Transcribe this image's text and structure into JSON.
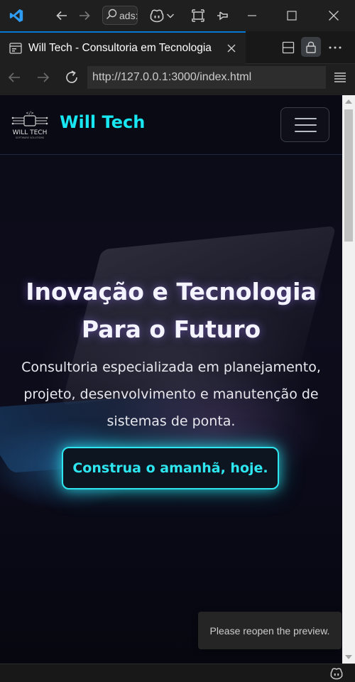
{
  "titlebar": {
    "search_text": "ads:",
    "icons": [
      "vscode-logo-icon",
      "arrow-left-icon",
      "arrow-right-icon",
      "search-icon",
      "copilot-icon",
      "chevron-down-icon",
      "layout-icon",
      "pin-icon",
      "minimize-icon",
      "maximize-icon",
      "close-icon"
    ]
  },
  "tab": {
    "title": "Will Tech - Consultoria em Tecnologia"
  },
  "address_bar": {
    "url": "http://127.0.0.1:3000/index.html"
  },
  "site": {
    "brand": "Will Tech",
    "logo_text": "WILL TECH",
    "logo_subtext": "SOFTWARE SOLUTIONS",
    "hero_title_line1": "Inovação e Tecnologia",
    "hero_title_line2": "Para o Futuro",
    "hero_sub_line1": "Consultoria especializada em planejamento,",
    "hero_sub_line2": "projeto, desenvolvimento e manutenção de",
    "hero_sub_line3": "sistemas de ponta.",
    "cta_label": "Construa o amanhã, hoje."
  },
  "toast": {
    "message": "Please reopen the preview."
  },
  "colors": {
    "accent": "#18e6f0",
    "vscode_blue": "#0078d4",
    "page_bg": "#0a0a14"
  }
}
